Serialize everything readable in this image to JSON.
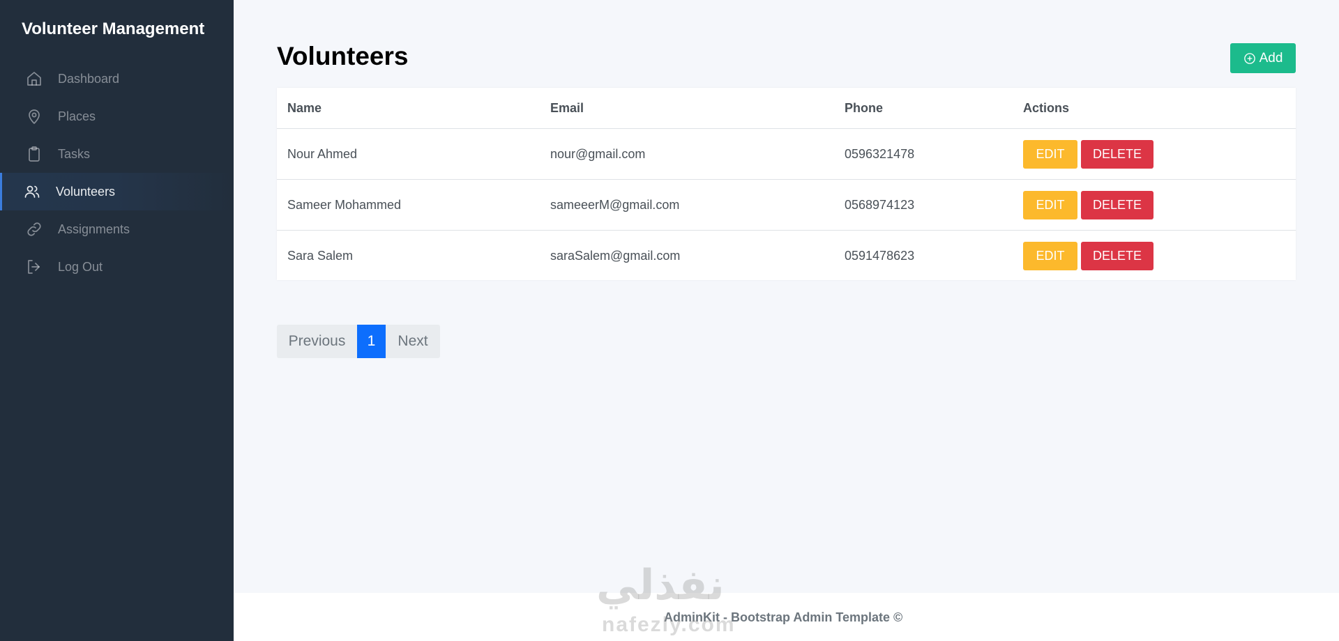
{
  "sidebar": {
    "brand": "Volunteer Management",
    "items": [
      {
        "label": "Dashboard",
        "icon": "home-icon",
        "active": false
      },
      {
        "label": "Places",
        "icon": "map-pin-icon",
        "active": false
      },
      {
        "label": "Tasks",
        "icon": "clipboard-icon",
        "active": false
      },
      {
        "label": "Volunteers",
        "icon": "users-icon",
        "active": true
      },
      {
        "label": "Assignments",
        "icon": "link-icon",
        "active": false
      },
      {
        "label": "Log Out",
        "icon": "log-out-icon",
        "active": false
      }
    ]
  },
  "main": {
    "title": "Volunteers",
    "add_label": "Add",
    "table": {
      "headers": [
        "Name",
        "Email",
        "Phone",
        "Actions"
      ],
      "rows": [
        {
          "name": "Nour Ahmed",
          "email": "nour@gmail.com",
          "phone": "0596321478"
        },
        {
          "name": "Sameer Mohammed",
          "email": "sameeerM@gmail.com",
          "phone": "0568974123"
        },
        {
          "name": "Sara Salem",
          "email": "saraSalem@gmail.com",
          "phone": "0591478623"
        }
      ],
      "edit_label": "EDIT",
      "delete_label": "DELETE"
    },
    "pagination": {
      "previous": "Previous",
      "current": "1",
      "next": "Next"
    }
  },
  "footer": {
    "text": "AdminKit - Bootstrap Admin Template ©"
  },
  "watermark": {
    "arabic": "نفذلي",
    "latin": "nafezly.com"
  },
  "colors": {
    "sidebar_bg": "#222e3c",
    "active_accent": "#3b7ddd",
    "add_button": "#1cbb8c",
    "edit_button": "#fcb92c",
    "delete_button": "#dc3545",
    "page_current": "#0d6efd"
  }
}
